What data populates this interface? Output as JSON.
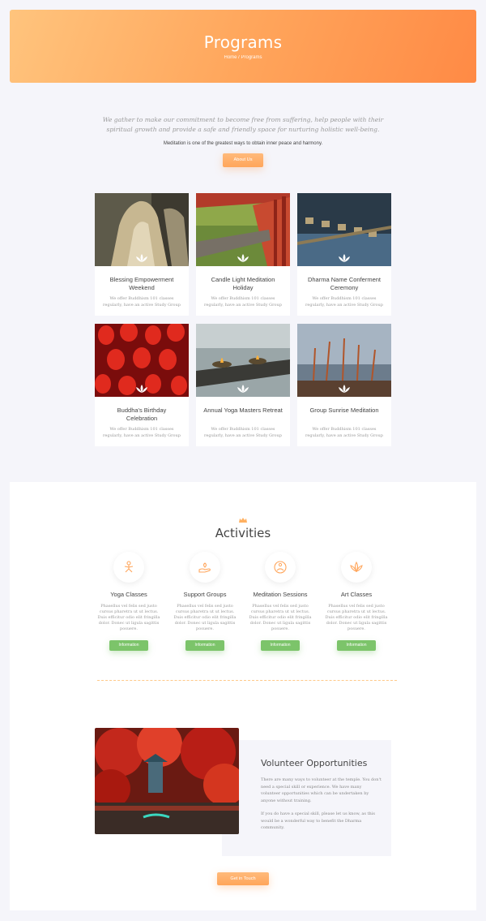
{
  "hero": {
    "title": "Programs",
    "breadcrumb": "Home / Programs"
  },
  "intro": {
    "quote": "We gather to make our commitment to become free from suffering, help people with their spiritual growth and provide a safe and friendly space for nurturing holistic well-being.",
    "subtitle": "Meditation is one of the greatest ways to obtain inner peace and harmony.",
    "button": "About Us"
  },
  "programs": [
    {
      "title": "Blessing Empowerment Weekend",
      "desc": "We offer Buddhism 101 classes regularly, have an active Study Group",
      "image": "buddha-hand-photo"
    },
    {
      "title": "Candle Light Meditation Holiday",
      "desc": "We offer Buddhism 101 classes regularly, have an active Study Group",
      "image": "temple-corridor-photo"
    },
    {
      "title": "Dharma Name Conferment Ceremony",
      "desc": "We offer Buddhism 101 classes regularly, have an active Study Group",
      "image": "water-ladles-photo"
    },
    {
      "title": "Buddha's Birthday Celebration",
      "desc": "We offer Buddhism 101 classes regularly, have an active Study Group",
      "image": "red-lanterns-photo"
    },
    {
      "title": "Annual Yoga Masters Retreat",
      "desc": "We offer Buddhism 101 classes regularly, have an active Study Group",
      "image": "oil-lamps-photo"
    },
    {
      "title": "Group Sunrise Meditation",
      "desc": "We offer Buddhism 101 classes regularly, have an active Study Group",
      "image": "incense-sticks-photo"
    }
  ],
  "activities": {
    "title": "Activities",
    "items": [
      {
        "name": "Yoga Classes",
        "desc": "Phasellus vel felis sed justo cursus pharetra ut ut lectus. Duis efficitur odio elit fringilla dolor. Donec ut ligula sagittis posuere.",
        "button": "Information",
        "icon": "yoga-icon"
      },
      {
        "name": "Support Groups",
        "desc": "Phasellus vel felis sed justo cursus pharetra ut ut lectus. Duis efficitur odio elit fringilla dolor. Donec ut ligula sagittis posuere.",
        "button": "Information",
        "icon": "support-hand-icon"
      },
      {
        "name": "Meditation Sessions",
        "desc": "Phasellus vel felis sed justo cursus pharetra ut ut lectus. Duis efficitur odio elit fringilla dolor. Donec ut ligula sagittis posuere.",
        "button": "Information",
        "icon": "meditation-icon"
      },
      {
        "name": "Art Classes",
        "desc": "Phasellus vel felis sed justo cursus pharetra ut ut lectus. Duis efficitur odio elit fringilla dolor. Donec ut ligula sagittis posuere.",
        "button": "Information",
        "icon": "lotus-art-icon"
      }
    ]
  },
  "volunteer": {
    "title": "Volunteer Opportunities",
    "p1": "There are many ways to volunteer at the temple. You don't need a special skill or experience. We have many volunteer opportunities which can be undertaken by anyone without training.",
    "p2": "If you do have a special skill, please let us know, as this would be a wonderful way to benefit the Dharma community.",
    "button": "Get in Touch"
  },
  "colors": {
    "accent": "#ffa65c",
    "green": "#7cc46a",
    "background": "#f5f5fa"
  }
}
